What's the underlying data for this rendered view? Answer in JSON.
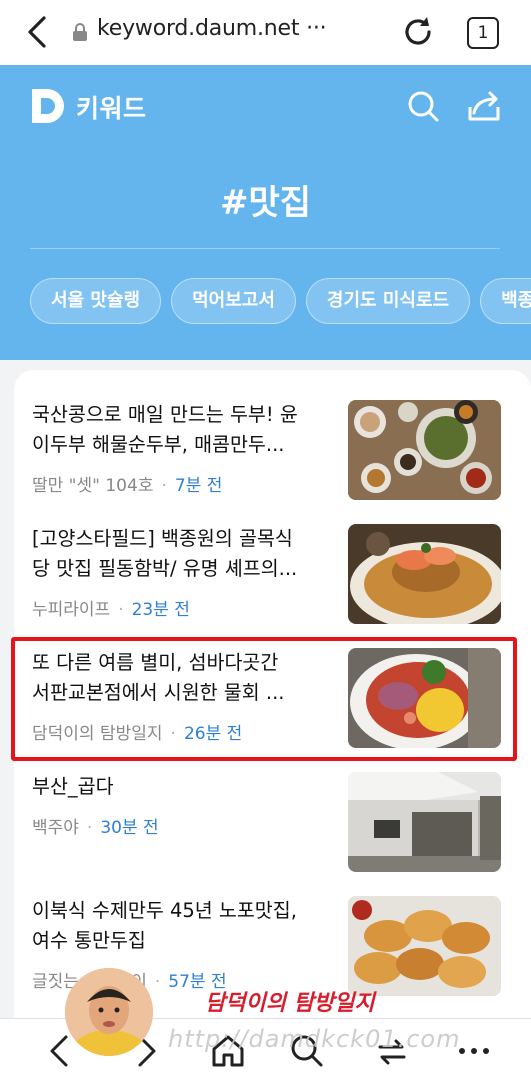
{
  "browser": {
    "url": "keyword.daum.net ···",
    "tab_count": "1"
  },
  "header": {
    "logo_text": "키워드",
    "hashtag": "#맛집",
    "chips": [
      "서울 맛슐랭",
      "먹어보고서",
      "경기도 미식로드",
      "백종"
    ]
  },
  "articles": [
    {
      "title_lines": [
        "국산콩으로 매일 만드는 두부! 윤",
        "이두부 해물순두부, 매콤만두..."
      ],
      "source": "딸만 \"셋\" 104호",
      "time": "7분 전"
    },
    {
      "title_lines": [
        "[고양스타필드] 백종원의 골목식",
        "당 맛집 필동함박/ 유명 셰프의..."
      ],
      "source": "누피라이프",
      "time": "23분 전"
    },
    {
      "title_lines": [
        "또 다른 여름 별미, 섬바다곳간",
        "서판교본점에서 시원한 물회 ..."
      ],
      "source": "담덕이의 탐방일지",
      "time": "26분 전"
    },
    {
      "title_lines": [
        "부산_곱다"
      ],
      "source": "백주야",
      "time": "30분 전"
    },
    {
      "title_lines": [
        "이북식 수제만두 45년 노포맛집,",
        "여수 통만두집"
      ],
      "source": "글짓는 아재잠이",
      "time": "57분 전"
    }
  ],
  "watermark": {
    "korean": "담덕이의 탐방일지",
    "url": "http://damdkck01.com"
  },
  "colors": {
    "header_bg": "#64b5ee",
    "time_blue": "#2f7fd6",
    "highlight_red": "#e4141a"
  }
}
